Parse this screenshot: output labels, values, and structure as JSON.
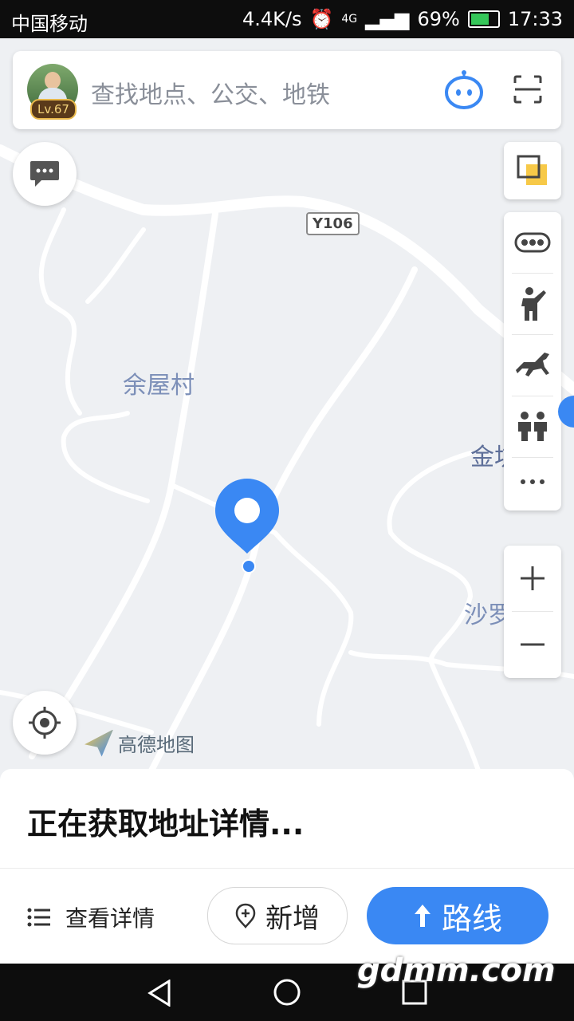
{
  "status_bar": {
    "carrier": "中国移动",
    "speed": "4.4K/s",
    "network": "4G",
    "battery": "69%",
    "time": "17:33"
  },
  "search": {
    "level": "Lv.67",
    "placeholder": "查找地点、公交、地铁"
  },
  "map": {
    "road_label": "Y106",
    "villages": [
      "余屋村",
      "金坑",
      "沙罗"
    ],
    "logo_text": "高德地图"
  },
  "bottom_panel": {
    "title": "正在获取地址详情...",
    "detail_label": "查看详情",
    "add_label": "新增",
    "route_label": "路线"
  },
  "watermark": "gdmm.com"
}
